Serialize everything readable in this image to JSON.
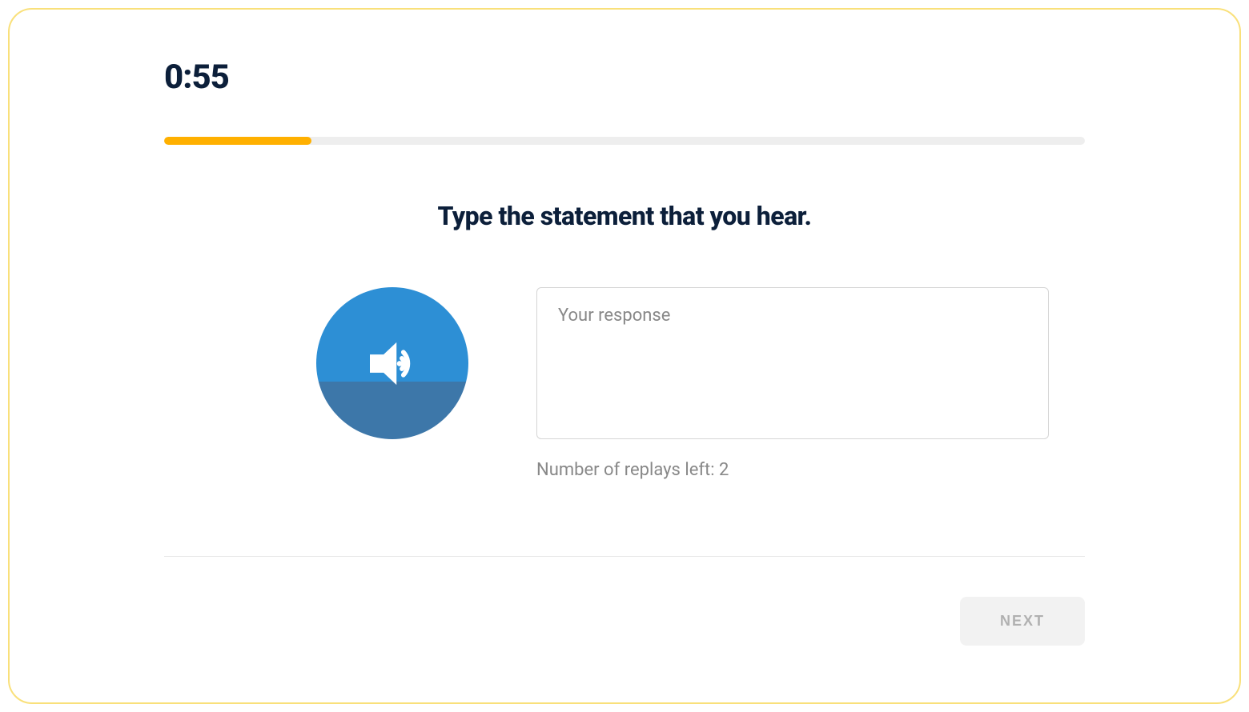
{
  "timer": "0:55",
  "progress_percent": 16,
  "prompt": "Type the statement that you hear.",
  "response": {
    "placeholder": "Your response",
    "value": ""
  },
  "replays_text": "Number of replays left: 2",
  "next_button": "NEXT"
}
